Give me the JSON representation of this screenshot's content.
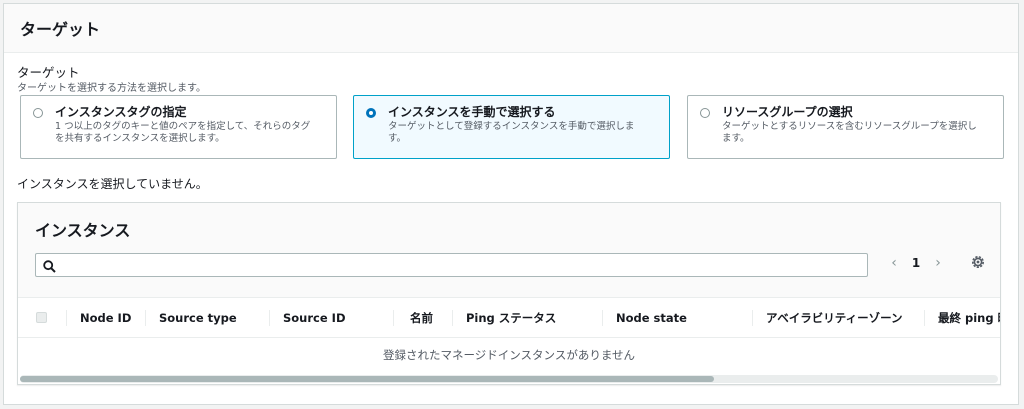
{
  "panel": {
    "title": "ターゲット"
  },
  "target": {
    "label": "ターゲット",
    "description": "ターゲットを選択する方法を選択します。",
    "options": [
      {
        "title": "インスタンスタグの指定",
        "desc1": "1 つ以上のタグのキーと値のペアを指定して、それらのタグ",
        "desc2": "を共有するインスタンスを選択します。",
        "selected": false
      },
      {
        "title": "インスタンスを手動で選択する",
        "desc1": "ターゲットとして登録するインスタンスを手動で選択しま",
        "desc2": "す。",
        "selected": true
      },
      {
        "title": "リソースグループの選択",
        "desc1": "ターゲットとするリソースを含むリソースグループを選択し",
        "desc2": "ます。",
        "selected": false
      }
    ]
  },
  "status_text": "インスタンスを選択していません。",
  "instances": {
    "title": "インスタンス",
    "search": {
      "value": "",
      "placeholder": ""
    },
    "pager": {
      "prev": "‹",
      "page": "1",
      "next": "›"
    },
    "columns": [
      "Node ID",
      "Source type",
      "Source ID",
      "名前",
      "Ping ステータス",
      "Node state",
      "アベイラビリティーゾーン",
      "最終 ping 時"
    ],
    "empty_message": "登録されたマネージドインスタンスがありません",
    "scrollbar": {
      "position_fraction": 0.0,
      "visible_fraction": 0.71
    }
  },
  "colors": {
    "accent": "#0073bb",
    "selected_bg": "#f1faff",
    "selected_border": "#00a1c9"
  }
}
